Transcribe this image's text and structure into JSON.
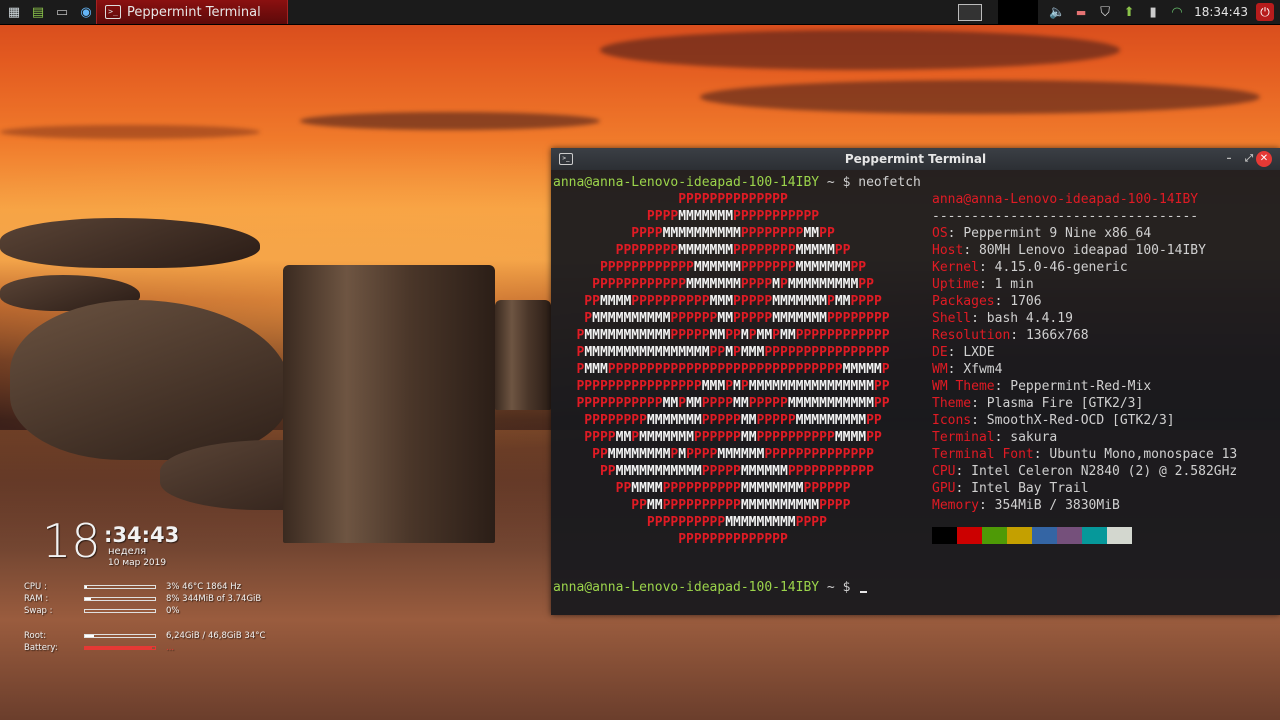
{
  "panel": {
    "task_title": "Peppermint Terminal",
    "clock": "18:34:43",
    "launchers": [
      "menu-icon",
      "files-icon",
      "terminal-icon",
      "browser-icon"
    ],
    "tray": [
      "pager",
      "volume-icon",
      "keyboard-flag-icon",
      "shield-icon",
      "update-icon",
      "battery-icon",
      "wifi-icon",
      "logout-icon"
    ]
  },
  "conky": {
    "hour": "18",
    "minsec": ":34:43",
    "day": "неделя",
    "date": "10 мар 2019",
    "rows": [
      {
        "label": "CPU :",
        "value": "3%  46°C  1864 Hz",
        "percent": 3
      },
      {
        "label": "RAM :",
        "value": "8%  344MiB of 3.74GiB",
        "percent": 8
      },
      {
        "label": "Swap :",
        "value": "0%",
        "percent": 0
      },
      {
        "label": "Root:",
        "value": "6,24GiB / 46,8GiB 34°C",
        "percent": 13
      },
      {
        "label": "Battery:",
        "value": "...",
        "percent": 95
      }
    ]
  },
  "terminal": {
    "title": "Peppermint Terminal",
    "prompt": "anna@anna-Lenovo-ideapad-100-14IBY",
    "prompt_suffix": " ~ $ ",
    "command": "neofetch",
    "logo": [
      "                PPPPPPPPPPPPPP",
      "            PPPPMMMMMMMPPPPPPPPPPP",
      "          PPPPMMMMMMMMMMPPPPPPPPMMPP",
      "        PPPPPPPPMMMMMMMPPPPPPPPMMMMMPP",
      "      PPPPPPPPPPPPMMMMMMPPPPPPPMMMMMMMPP",
      "     PPPPPPPPPPPPMMMMMMMPPPPMPMMMMMMMMMPP",
      "    PPMMMMPPPPPPPPPPMMMPPPPPMMMMMMMPMMPPPP",
      "    PMMMMMMMMMMPPPPPPMMPPPPPMMMMMMMPPPPPPPP",
      "   PMMMMMMMMMMMPPPPPMMPPMPMMPMMPPPPPPPPPPPP",
      "   PMMMMMMMMMMMMMMMMPPMPMMMPPPPPPPPPPPPPPPP",
      "   PMMMPPPPPPPPPPPPPPPPPPPPPPPPPPPPPPMMMMMP",
      "   PPPPPPPPPPPPPPPPMMMPMPMMMMMMMMMMMMMMMMPP",
      "   PPPPPPPPPPPMMPMMPPPPMMPPPPPMMMMMMMMMMMPP",
      "    PPPPPPPPMMMMMMMPPPPPMMPPPPPMMMMMMMMMPP",
      "    PPPPMMPMMMMMMMPPPPPPMMPPPPPPPPPPMMMMPP",
      "     PPMMMMMMMMPMPPPPMMMMMMPPPPPPPPPPPPPP",
      "      PPMMMMMMMMMMMPPPPPMMMMMMPPPPPPPPPPP",
      "        PPMMMMPPPPPPPPPPMMMMMMMMPPPPPP",
      "          PPMMPPPPPPPPPPMMMMMMMMMMPPPP",
      "            PPPPPPPPPPMMMMMMMMMPPPP",
      "                PPPPPPPPPPPPPP"
    ],
    "info_header": "anna@anna-Lenovo-ideapad-100-14IBY",
    "info_separator": "----------------------------------",
    "info": [
      {
        "key": "OS",
        "value": "Peppermint 9 Nine x86_64"
      },
      {
        "key": "Host",
        "value": "80MH Lenovo ideapad 100-14IBY"
      },
      {
        "key": "Kernel",
        "value": "4.15.0-46-generic"
      },
      {
        "key": "Uptime",
        "value": "1 min"
      },
      {
        "key": "Packages",
        "value": "1706"
      },
      {
        "key": "Shell",
        "value": "bash 4.4.19"
      },
      {
        "key": "Resolution",
        "value": "1366x768"
      },
      {
        "key": "DE",
        "value": "LXDE"
      },
      {
        "key": "WM",
        "value": "Xfwm4"
      },
      {
        "key": "WM Theme",
        "value": "Peppermint-Red-Mix"
      },
      {
        "key": "Theme",
        "value": "Plasma Fire [GTK2/3]"
      },
      {
        "key": "Icons",
        "value": "SmoothX-Red-OCD [GTK2/3]"
      },
      {
        "key": "Terminal",
        "value": "sakura"
      },
      {
        "key": "Terminal Font",
        "value": "Ubuntu Mono,monospace 13"
      },
      {
        "key": "CPU",
        "value": "Intel Celeron N2840 (2) @ 2.582GHz"
      },
      {
        "key": "GPU",
        "value": "Intel Bay Trail"
      },
      {
        "key": "Memory",
        "value": "354MiB / 3830MiB"
      }
    ],
    "palette": [
      "#000000",
      "#cc0000",
      "#4e9a06",
      "#c4a000",
      "#3465a4",
      "#75507b",
      "#06989a",
      "#d3d7cf"
    ]
  }
}
